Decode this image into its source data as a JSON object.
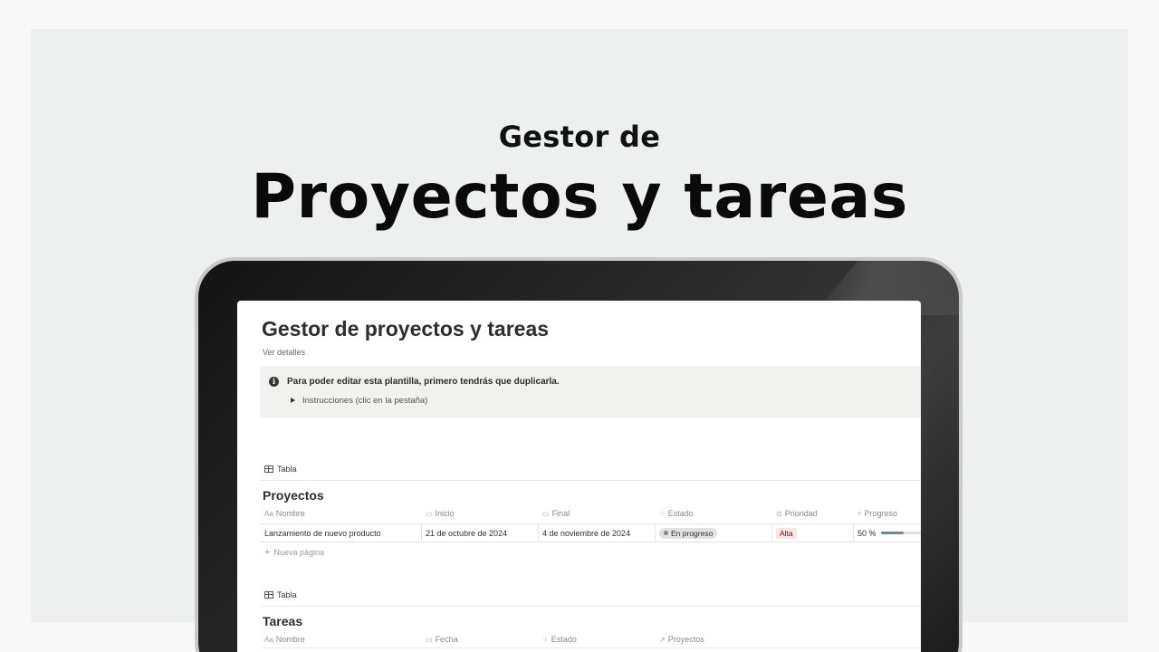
{
  "hero": {
    "subtitle": "Gestor de",
    "title": "Proyectos y tareas"
  },
  "page": {
    "title": "Gestor de proyectos y tareas",
    "details_link": "Ver detalles"
  },
  "callout": {
    "icon": "info-icon",
    "message": "Para poder editar esta plantilla, primero tendrás que duplicarla.",
    "toggle_label": "Instrucciones (clic en la pestaña)"
  },
  "projects": {
    "view_label": "Tabla",
    "title": "Proyectos",
    "columns": [
      {
        "icon": "Aa",
        "label": "Nombre"
      },
      {
        "icon": "calendar-icon",
        "label": "Inicio"
      },
      {
        "icon": "calendar-icon",
        "label": "Final"
      },
      {
        "icon": "status-icon",
        "label": "Estado"
      },
      {
        "icon": "select-icon",
        "label": "Prioridad"
      },
      {
        "icon": "search-icon",
        "label": "Progreso"
      }
    ],
    "rows": [
      {
        "nombre": "Lanzamiento de nuevo producto",
        "inicio": "21 de octubre de 2024",
        "final": "4 de noviembre de 2024",
        "estado": "En progreso",
        "prioridad": "Alta",
        "progreso_label": "50 %",
        "progreso": 0.5
      }
    ],
    "new_page": "Nueva página"
  },
  "tasks": {
    "view_label": "Tabla",
    "title": "Tareas",
    "columns": [
      {
        "icon": "Aa",
        "label": "Nombre"
      },
      {
        "icon": "calendar-icon",
        "label": "Fecha"
      },
      {
        "icon": "status-icon",
        "label": "Estado"
      },
      {
        "icon": "relation-icon",
        "label": "Proyectos"
      }
    ]
  },
  "colors": {
    "status_dot": "#6f8b8a",
    "priority_bg": "#fbe4e4",
    "progress_fill": "#6e8a96"
  }
}
